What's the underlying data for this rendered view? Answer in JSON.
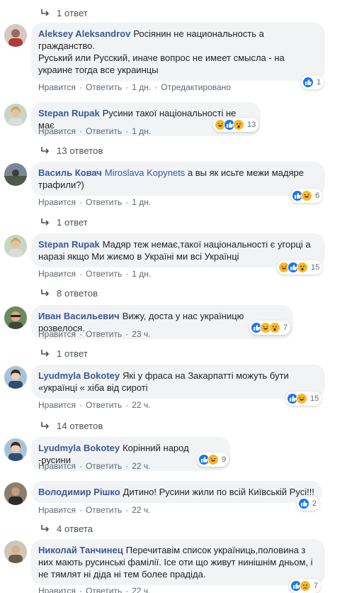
{
  "replies": [
    {
      "label": "1 ответ"
    },
    {
      "label": "13 ответов"
    },
    {
      "label": "1 ответ"
    },
    {
      "label": "8 ответов"
    },
    {
      "label": "1 ответ"
    },
    {
      "label": "14 ответов"
    },
    {
      "label": "4 ответа"
    }
  ],
  "actions": {
    "like": "Нравится",
    "reply": "Ответить",
    "sep": "·",
    "edited": "Отредактировано"
  },
  "comments": [
    {
      "author": "Aleksey Aleksandrov",
      "lines": [
        "Росіянин не национальность а",
        "гражданство.",
        "Руський или Русский, иначе вопрос не имеет смысла - на",
        "украине тогда все украинцы"
      ],
      "time": "1 дн.",
      "edited": true,
      "reactions": [
        "like"
      ],
      "count": "1"
    },
    {
      "author": "Stepan Rupak",
      "lines": [
        "Русини такої національності не має"
      ],
      "time": "1 дн.",
      "reactions": [
        "haha",
        "like",
        "wow"
      ],
      "count": "13"
    },
    {
      "author": "Василь Ковач",
      "mention": "Miroslava Kopynets",
      "lines": [
        "а вы як исьте межи мадяре",
        "трафили?)"
      ],
      "time": "1 дн.",
      "reactions": [
        "like",
        "haha"
      ],
      "count": "6"
    },
    {
      "author": "Stepan Rupak",
      "lines": [
        "Мадяр теж немає,такої національності є угорці а",
        "наразі якщо Ми жиємо в Україні ми всі Українці"
      ],
      "time": "1 дн.",
      "reactions": [
        "haha",
        "like",
        "wow"
      ],
      "count": "15"
    },
    {
      "author": "Иван Васильевич",
      "lines": [
        "Вижу, доста у нас україницю розвелося."
      ],
      "time": "23 ч.",
      "reactions": [
        "like",
        "haha",
        "wow"
      ],
      "count": "7"
    },
    {
      "author": "Lyudmyla Bokotey",
      "lines": [
        "Які у фраса на Закарпатті можуть бути",
        "«українці « хіба від сироті"
      ],
      "time": "22 ч.",
      "reactions": [
        "like",
        "haha"
      ],
      "count": "15"
    },
    {
      "author": "Lyudmyla Bokotey",
      "lines": [
        "Корінний народ -русини"
      ],
      "time": "22 ч.",
      "reactions": [
        "like",
        "haha"
      ],
      "count": "9"
    },
    {
      "author": "Володимир Рішко",
      "lines": [
        "Дитино! Русини жили по всій Київській Русі!!!"
      ],
      "time": "22 ч.",
      "reactions": [
        "like"
      ],
      "count": "2"
    },
    {
      "author": "Николай Танчинец",
      "lines": [
        "Перечитавім список україниць,половина з",
        "них мають русинські фамілії. Ісе оти що живут нинішнім дньом, і",
        "не тямлят ні діда ні тем более прадіда."
      ],
      "time": "22 ч.",
      "reactions": [
        "like",
        "sad"
      ],
      "count": "7"
    }
  ],
  "colors": {
    "link": "#385898",
    "bubble": "#f2f3f5",
    "meta": "#606770",
    "like": "#1877f2",
    "haha": "#f7b928"
  }
}
